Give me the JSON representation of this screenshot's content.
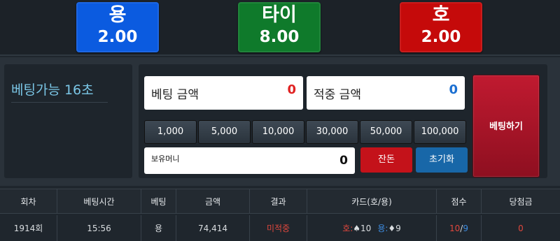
{
  "odds": {
    "dragon": {
      "name": "용",
      "rate": "2.00"
    },
    "tie": {
      "name": "타이",
      "rate": "8.00"
    },
    "tiger": {
      "name": "호",
      "rate": "2.00"
    }
  },
  "betting_panel": {
    "countdown": "베팅가능 16초",
    "bet_amount_label": "베팅 금액",
    "bet_amount_value": "0",
    "win_amount_label": "적중 금액",
    "win_amount_value": "0",
    "chips": [
      "1,000",
      "5,000",
      "10,000",
      "30,000",
      "50,000",
      "100,000"
    ],
    "holding_label": "보유머니",
    "holding_value": "0",
    "change_button": "잔돈",
    "reset_button": "초기화",
    "bet_button": "베팅하기"
  },
  "history_table": {
    "headers": [
      "회차",
      "베팅시간",
      "베팅",
      "금액",
      "결과",
      "카드(호/용)",
      "점수",
      "당첨금"
    ],
    "rows": [
      {
        "round": "1914회",
        "time": "15:56",
        "bet": "용",
        "amount": "74,414",
        "result": "미적중",
        "cards": {
          "tiger_label": "호:",
          "tiger_card": "♠10",
          "dragon_label": "용:",
          "dragon_card": "♦9"
        },
        "score_tiger": "10",
        "score_sep": "/",
        "score_dragon": "9",
        "payout": "0"
      }
    ]
  },
  "colors": {
    "dragon": "#0b5be0",
    "tie": "#0f7a2b",
    "tiger": "#c50a0a",
    "countdown_text": "#7bc6e6",
    "bet_button": "#c01a30",
    "reset_button": "#1867a8",
    "change_button": "#c4121a"
  }
}
